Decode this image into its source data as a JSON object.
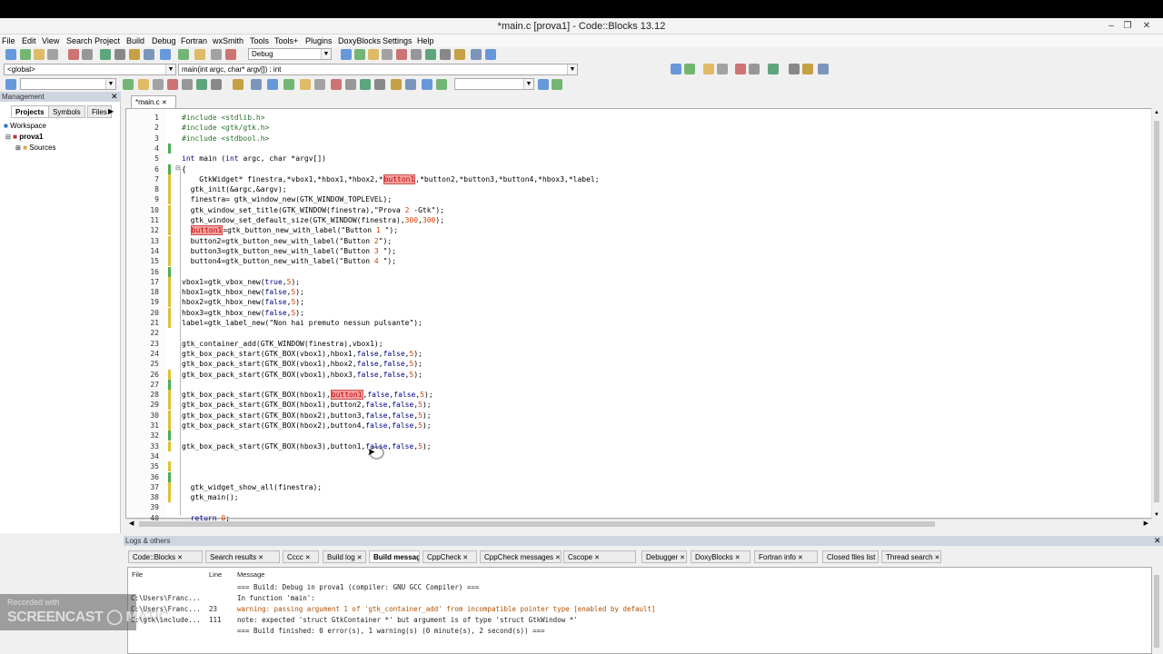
{
  "window": {
    "title": "*main.c [prova1] - Code::Blocks 13.12",
    "min": "–",
    "max": "❐",
    "close": "✕"
  },
  "menu": [
    "File",
    "Edit",
    "View",
    "Search",
    "Project",
    "Build",
    "Debug",
    "Fortran",
    "wxSmith",
    "Tools",
    "Tools+",
    "Plugins",
    "DoxyBlocks",
    "Settings",
    "Help"
  ],
  "toolbar": {
    "build_target": "Debug",
    "scope": "<global>",
    "function": "main(int argc, char* argv[]) : int",
    "search_value": "",
    "find_value": ""
  },
  "management": {
    "header": "Management",
    "tabs": [
      "Projects",
      "Symbols",
      "Files"
    ],
    "workspace": "Workspace",
    "project": "prova1",
    "folder": "Sources"
  },
  "editor": {
    "tab": "*main.c",
    "lines": [
      {
        "n": "1",
        "t": "#include <stdlib.h>"
      },
      {
        "n": "2",
        "t": "#include <gtk/gtk.h>"
      },
      {
        "n": "3",
        "t": "#include <stdbool.h>"
      },
      {
        "n": "4",
        "t": ""
      },
      {
        "n": "5",
        "t": "int main (int argc, char *argv[])"
      },
      {
        "n": "6",
        "t": "{"
      },
      {
        "n": "7",
        "t": "    GtkWidget* finestra,*vbox1,*hbox1,*hbox2,*button1,*button2,*button3,*button4,*hbox3,*label;"
      },
      {
        "n": "8",
        "t": "  gtk_init(&argc,&argv);"
      },
      {
        "n": "9",
        "t": "  finestra= gtk_window_new(GTK_WINDOW_TOPLEVEL);"
      },
      {
        "n": "10",
        "t": "  gtk_window_set_title(GTK_WINDOW(finestra),\"Prova 2 -Gtk\");"
      },
      {
        "n": "11",
        "t": "  gtk_window_set_default_size(GTK_WINDOW(finestra),300,300);"
      },
      {
        "n": "12",
        "t": "  button1=gtk_button_new_with_label(\"Button 1 \");"
      },
      {
        "n": "13",
        "t": "  button2=gtk_button_new_with_label(\"Button 2\");"
      },
      {
        "n": "14",
        "t": "  button3=gtk_button_new_with_label(\"Button 3 \");"
      },
      {
        "n": "15",
        "t": "  button4=gtk_button_new_with_label(\"Button 4 \");"
      },
      {
        "n": "16",
        "t": ""
      },
      {
        "n": "17",
        "t": "vbox1=gtk_vbox_new(true,5);"
      },
      {
        "n": "18",
        "t": "hbox1=gtk_hbox_new(false,5);"
      },
      {
        "n": "19",
        "t": "hbox2=gtk_hbox_new(false,5);"
      },
      {
        "n": "20",
        "t": "hbox3=gtk_hbox_new(false,5);"
      },
      {
        "n": "21",
        "t": "label=gtk_label_new(\"Non hai premuto nessun pulsante\");"
      },
      {
        "n": "22",
        "t": ""
      },
      {
        "n": "23",
        "t": "gtk_container_add(GTK_WINDOW(finestra),vbox1);"
      },
      {
        "n": "24",
        "t": "gtk_box_pack_start(GTK_BOX(vbox1),hbox1,false,false,5);"
      },
      {
        "n": "25",
        "t": "gtk_box_pack_start(GTK_BOX(vbox1),hbox2,false,false,5);"
      },
      {
        "n": "26",
        "t": "gtk_box_pack_start(GTK_BOX(vbox1),hbox3,false,false,5);"
      },
      {
        "n": "27",
        "t": ""
      },
      {
        "n": "28",
        "t": "gtk_box_pack_start(GTK_BOX(hbox1),button1,false,false,5);"
      },
      {
        "n": "29",
        "t": "gtk_box_pack_start(GTK_BOX(hbox1),button2,false,false,5);"
      },
      {
        "n": "30",
        "t": "gtk_box_pack_start(GTK_BOX(hbox2),button3,false,false,5);"
      },
      {
        "n": "31",
        "t": "gtk_box_pack_start(GTK_BOX(hbox2),button4,false,false,5);"
      },
      {
        "n": "32",
        "t": ""
      },
      {
        "n": "33",
        "t": "gtk_box_pack_start(GTK_BOX(hbox3),button1,false,false,5);"
      },
      {
        "n": "34",
        "t": ""
      },
      {
        "n": "35",
        "t": ""
      },
      {
        "n": "36",
        "t": ""
      },
      {
        "n": "37",
        "t": "  gtk_widget_show_all(finestra);"
      },
      {
        "n": "38",
        "t": "  gtk_main();"
      },
      {
        "n": "39",
        "t": ""
      },
      {
        "n": "40",
        "t": "  return 0;"
      }
    ]
  },
  "logs": {
    "header": "Logs & others",
    "tabs": [
      "Code::Blocks",
      "Search results",
      "Cccc",
      "Build log",
      "Build messages",
      "CppCheck",
      "CppCheck messages",
      "Cscope",
      "Debugger",
      "DoxyBlocks",
      "Fortran info",
      "Closed files list",
      "Thread search"
    ],
    "columns": [
      "File",
      "Line",
      "Message"
    ],
    "rows": [
      {
        "file": "",
        "line": "",
        "msg": "=== Build: Debug in prova1 (compiler: GNU GCC Compiler) ==="
      },
      {
        "file": "C:\\Users\\Franc...",
        "line": "",
        "msg": "In function 'main':"
      },
      {
        "file": "C:\\Users\\Franc...",
        "line": "23",
        "msg": "warning: passing argument 1 of 'gtk_container_add' from incompatible pointer type [enabled by default]"
      },
      {
        "file": "C:\\gtk\\include...",
        "line": "111",
        "msg": "note: expected 'struct GtkContainer *' but argument is of type 'struct GtkWindow *'"
      },
      {
        "file": "",
        "line": "",
        "msg": "=== Build finished: 0 error(s), 1 warning(s) (0 minute(s), 2 second(s)) ==="
      }
    ]
  },
  "watermark": {
    "line1": "Recorded with",
    "line2": "SCREENCAST ◯ MATIC"
  }
}
